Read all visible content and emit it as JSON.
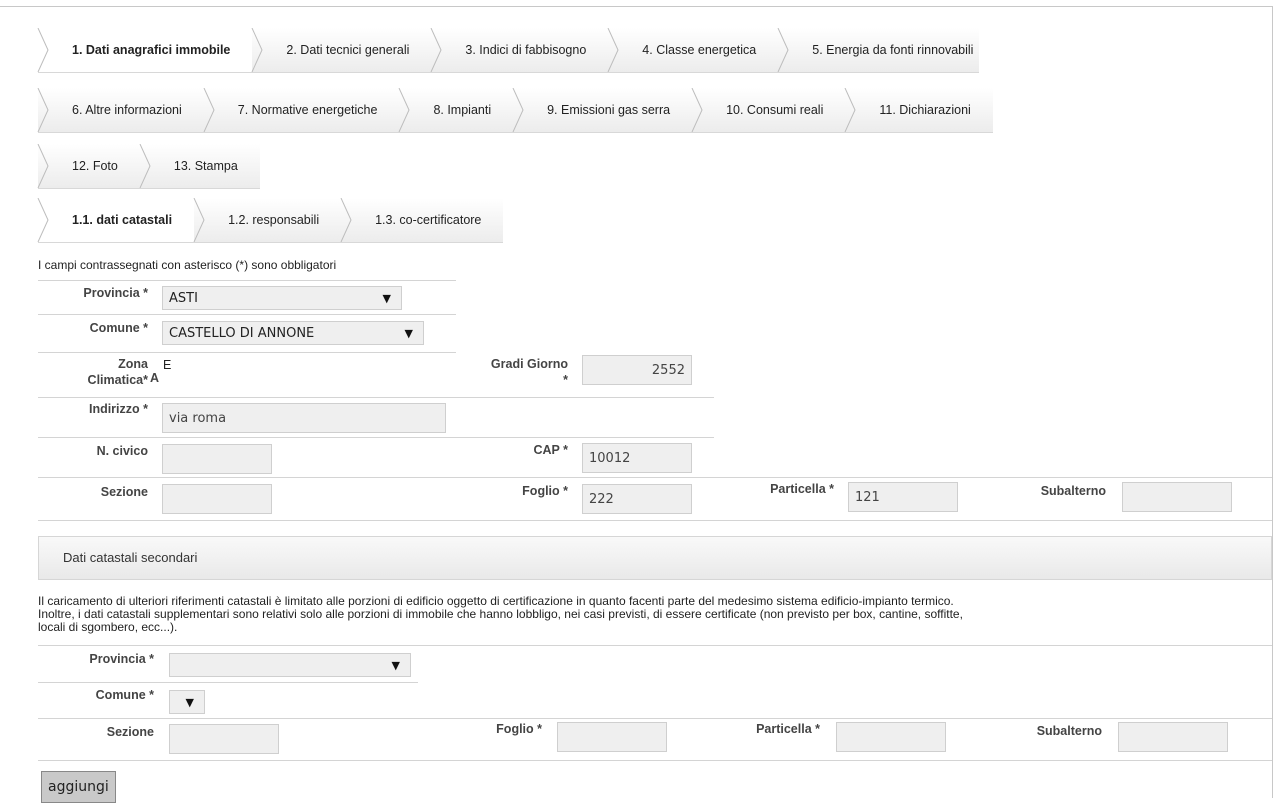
{
  "tabs": {
    "row1": [
      {
        "label": "1. Dati anagrafici immobile",
        "active": true
      },
      {
        "label": "2. Dati tecnici generali"
      },
      {
        "label": "3. Indici di fabbisogno"
      },
      {
        "label": "4. Classe energetica"
      },
      {
        "label": "5. Energia da fonti rinnovabili"
      }
    ],
    "row2": [
      {
        "label": "6. Altre informazioni"
      },
      {
        "label": "7. Normative energetiche"
      },
      {
        "label": "8. Impianti"
      },
      {
        "label": "9. Emissioni gas serra"
      },
      {
        "label": "10. Consumi reali"
      },
      {
        "label": "11. Dichiarazioni"
      }
    ],
    "row3": [
      {
        "label": "12. Foto"
      },
      {
        "label": "13. Stampa"
      }
    ],
    "subtabs": [
      {
        "label": "1.1. dati catastali",
        "active": true
      },
      {
        "label": "1.2. responsabili"
      },
      {
        "label": "1.3. co-certificatore"
      }
    ]
  },
  "form": {
    "note": "I campi contrassegnati con asterisco (*) sono obbligatori",
    "provincia": {
      "label": "Provincia *",
      "value": "ASTI"
    },
    "comune": {
      "label": "Comune *",
      "value": "CASTELLO DI ANNONE"
    },
    "zona": {
      "label_line1": "Zona",
      "label_line2": "Climatica*",
      "suffix": "A",
      "value": "E"
    },
    "gradi": {
      "label_line1": "Gradi Giorno",
      "label_line2": "*",
      "value": "2552"
    },
    "indirizzo": {
      "label": "Indirizzo *",
      "value": "via roma"
    },
    "civico": {
      "label": "N. civico",
      "value": ""
    },
    "cap": {
      "label": "CAP *",
      "value": "10012"
    },
    "sezione": {
      "label": "Sezione",
      "value": ""
    },
    "foglio": {
      "label": "Foglio *",
      "value": "222"
    },
    "particella": {
      "label": "Particella *",
      "value": "121"
    },
    "subalterno": {
      "label": "Subalterno",
      "value": ""
    }
  },
  "secondary": {
    "title": "Dati catastali secondari",
    "line1": "Il caricamento di ulteriori riferimenti catastali è limitato alle porzioni di edificio oggetto di certificazione in quanto facenti parte del medesimo sistema edificio-impianto termico.",
    "line2": "Inoltre, i dati catastali supplementari sono relativi solo alle porzioni di immobile che hanno lobbligo, nei casi previsti, di essere certificate (non previsto per box, cantine, soffitte,",
    "line3": "locali di sgombero, ecc...).",
    "provincia": {
      "label": "Provincia *",
      "value": ""
    },
    "comune": {
      "label": "Comune *",
      "value": ""
    },
    "sezione": {
      "label": "Sezione",
      "value": ""
    },
    "foglio": {
      "label": "Foglio *",
      "value": ""
    },
    "particella": {
      "label": "Particella *",
      "value": ""
    },
    "subalterno": {
      "label": "Subalterno",
      "value": ""
    },
    "add_button": "aggiungi"
  },
  "icons": {
    "dropdown": "▼"
  }
}
